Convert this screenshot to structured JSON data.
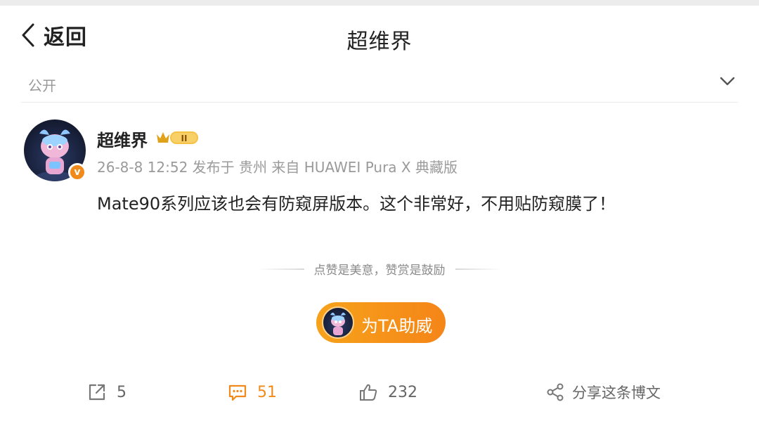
{
  "header": {
    "back_label": "返回",
    "title": "超维界"
  },
  "visibility": {
    "label": "公开"
  },
  "post": {
    "username": "超维界",
    "level_badge": "II",
    "meta": "26-8-8 12:52 发布于 贵州 来自 HUAWEI Pura X 典藏版",
    "text": "Mate90系列应该也会有防窥屏版本。这个非常好，不用贴防窥膜了！"
  },
  "tipping": {
    "slogan": "点赞是美意，赞赏是鼓励",
    "button_label": "为TA助威"
  },
  "actions": {
    "repost_count": "5",
    "comment_count": "51",
    "like_count": "232",
    "share_label": "分享这条博文"
  },
  "icons": {
    "back": "chevron-left-icon",
    "dropdown": "chevron-down-icon",
    "vip": "verified-v-icon",
    "repost": "repost-icon",
    "comment": "comment-icon",
    "like": "thumbs-up-icon",
    "share": "share-icon"
  },
  "colors": {
    "accent": "#f58518",
    "muted_text": "#999999",
    "comment_active": "#f08a1a"
  }
}
